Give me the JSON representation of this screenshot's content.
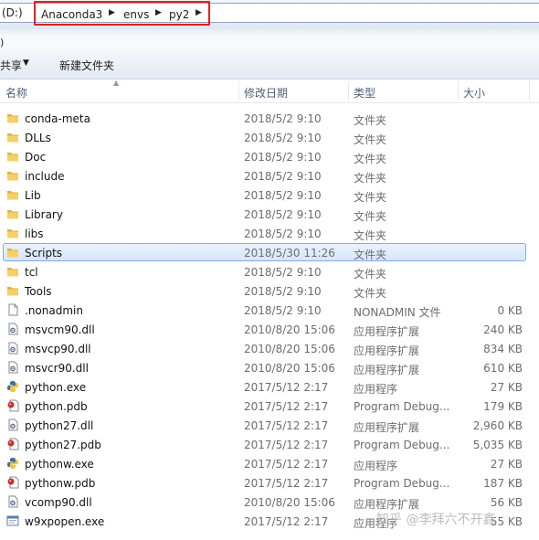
{
  "address": {
    "drive": "(D:)",
    "crumbs": [
      "Anaconda3",
      "envs",
      "py2"
    ]
  },
  "menu_fragment": ")",
  "toolbar": {
    "share_label": "共享",
    "new_folder_label": "新建文件夹"
  },
  "columns": {
    "name": "名称",
    "date": "修改日期",
    "type": "类型",
    "size": "大小"
  },
  "files": [
    {
      "name": "conda-meta",
      "date": "2018/5/2 9:10",
      "type": "文件夹",
      "size": "",
      "icon": "folder-icon"
    },
    {
      "name": "DLLs",
      "date": "2018/5/2 9:10",
      "type": "文件夹",
      "size": "",
      "icon": "folder-icon"
    },
    {
      "name": "Doc",
      "date": "2018/5/2 9:10",
      "type": "文件夹",
      "size": "",
      "icon": "folder-icon"
    },
    {
      "name": "include",
      "date": "2018/5/2 9:10",
      "type": "文件夹",
      "size": "",
      "icon": "folder-icon"
    },
    {
      "name": "Lib",
      "date": "2018/5/2 9:10",
      "type": "文件夹",
      "size": "",
      "icon": "folder-icon"
    },
    {
      "name": "Library",
      "date": "2018/5/2 9:10",
      "type": "文件夹",
      "size": "",
      "icon": "folder-icon"
    },
    {
      "name": "libs",
      "date": "2018/5/2 9:10",
      "type": "文件夹",
      "size": "",
      "icon": "folder-icon"
    },
    {
      "name": "Scripts",
      "date": "2018/5/30 11:26",
      "type": "文件夹",
      "size": "",
      "icon": "folder-icon",
      "selected": true
    },
    {
      "name": "tcl",
      "date": "2018/5/2 9:10",
      "type": "文件夹",
      "size": "",
      "icon": "folder-icon"
    },
    {
      "name": "Tools",
      "date": "2018/5/2 9:10",
      "type": "文件夹",
      "size": "",
      "icon": "folder-icon"
    },
    {
      "name": ".nonadmin",
      "date": "2018/5/2 9:10",
      "type": "NONADMIN 文件",
      "size": "0 KB",
      "icon": "blank-file-icon"
    },
    {
      "name": "msvcm90.dll",
      "date": "2010/8/20 15:06",
      "type": "应用程序扩展",
      "size": "240 KB",
      "icon": "dll-icon"
    },
    {
      "name": "msvcp90.dll",
      "date": "2010/8/20 15:06",
      "type": "应用程序扩展",
      "size": "834 KB",
      "icon": "dll-icon"
    },
    {
      "name": "msvcr90.dll",
      "date": "2010/8/20 15:06",
      "type": "应用程序扩展",
      "size": "610 KB",
      "icon": "dll-icon"
    },
    {
      "name": "python.exe",
      "date": "2017/5/12 2:17",
      "type": "应用程序",
      "size": "27 KB",
      "icon": "python-icon"
    },
    {
      "name": "python.pdb",
      "date": "2017/5/12 2:17",
      "type": "Program Debug...",
      "size": "179 KB",
      "icon": "pdb-icon"
    },
    {
      "name": "python27.dll",
      "date": "2017/5/12 2:17",
      "type": "应用程序扩展",
      "size": "2,960 KB",
      "icon": "dll-icon"
    },
    {
      "name": "python27.pdb",
      "date": "2017/5/12 2:17",
      "type": "Program Debug...",
      "size": "5,035 KB",
      "icon": "pdb-icon"
    },
    {
      "name": "pythonw.exe",
      "date": "2017/5/12 2:17",
      "type": "应用程序",
      "size": "27 KB",
      "icon": "python-icon"
    },
    {
      "name": "pythonw.pdb",
      "date": "2017/5/12 2:17",
      "type": "Program Debug...",
      "size": "187 KB",
      "icon": "pdb-icon"
    },
    {
      "name": "vcomp90.dll",
      "date": "2010/8/20 15:06",
      "type": "应用程序扩展",
      "size": "56 KB",
      "icon": "dll-icon"
    },
    {
      "name": "w9xpopen.exe",
      "date": "2017/5/12 2:17",
      "type": "应用程序",
      "size": "55 KB",
      "icon": "window-exe-icon"
    }
  ],
  "watermark": "知乎 @李拜六不开鑫",
  "colors": {
    "highlight_border": "#e02020",
    "selection": "#d4e7fb",
    "folder": "#f0c24a"
  }
}
